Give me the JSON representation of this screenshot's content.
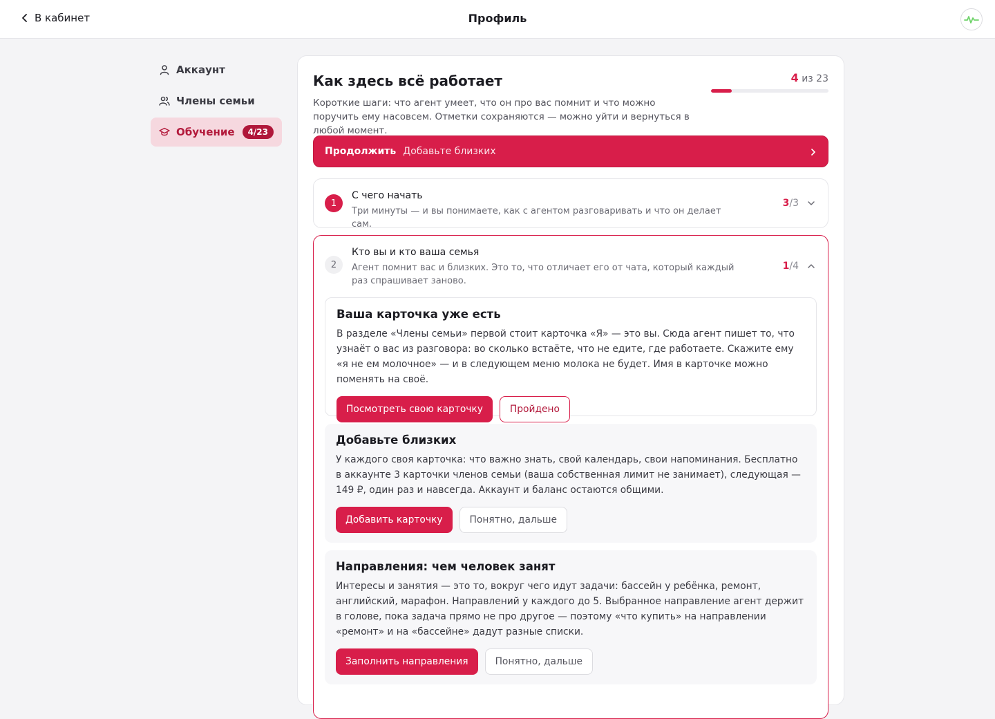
{
  "header": {
    "back_label": "В кабинет",
    "title": "Профиль"
  },
  "sidebar": {
    "items": [
      {
        "label": "Аккаунт",
        "icon": "user-icon"
      },
      {
        "label": "Члены семьи",
        "icon": "users-icon"
      },
      {
        "label": "Обучение",
        "icon": "graduation-cap-icon",
        "badge": "4/23",
        "active": true
      }
    ]
  },
  "onboarding": {
    "title": "Как здесь всё работает",
    "description": "Короткие шаги: что агент умеет, что он про вас помнит и что можно поручить ему насовсем. Отметки сохраняются — можно уйти и вернуться в любой момент.",
    "progress": {
      "done": "4",
      "of_label": "из 23",
      "fraction": 0.174
    },
    "continue": {
      "label": "Продолжить",
      "next": "Добавьте близких"
    },
    "sections": [
      {
        "number": "1",
        "title": "С чего начать",
        "description": "Три минуты — и вы понимаете, как с агентом разговаривать и что он делает сам.",
        "done": "3",
        "total": "/3",
        "expanded": false
      },
      {
        "number": "2",
        "title": "Кто вы и кто ваша семья",
        "description": "Агент помнит вас и близких. Это то, что отличает его от чата, который каждый раз спрашивает заново.",
        "done": "1",
        "total": "/4",
        "expanded": true,
        "lessons": [
          {
            "title": "Ваша карточка уже есть",
            "text": "В разделе «Члены семьи» первой стоит карточка «Я» — это вы. Сюда агент пишет то, что узнаёт о вас из разговора: во сколько встаёте, что не едите, где работаете. Скажите ему «я не ем молочное» — и в следующем меню молока не будет. Имя в карточке можно поменять на своё.",
            "primary": "Посмотреть свою карточку",
            "secondary": "Пройдено",
            "completed": true
          },
          {
            "title": "Добавьте близких",
            "text": "У каждого своя карточка: что важно знать, свой календарь, свои напоминания. Бесплатно в аккаунте 3 карточки членов семьи (ваша собственная лимит не занимает), следующая — 149 ₽, один раз и навсегда. Аккаунт и баланс остаются общими.",
            "primary": "Добавить карточку",
            "secondary": "Понятно, дальше",
            "completed": false
          },
          {
            "title": "Направления: чем человек занят",
            "text": "Интересы и занятия — это то, вокруг чего идут задачи: бассейн у ребёнка, ремонт, английский, марафон. Направлений у каждого до 5. Выбранное направление агент держит в голове, пока задача прямо не про другое — поэтому «что купить» на направлении «ремонт» и на «бассейне» дадут разные списки.",
            "primary": "Заполнить направления",
            "secondary": "Понятно, дальше",
            "completed": false
          }
        ]
      }
    ]
  },
  "colors": {
    "accent": "#d81e4a",
    "accent_soft": "#f6d8df",
    "background": "#f4f4f6"
  }
}
